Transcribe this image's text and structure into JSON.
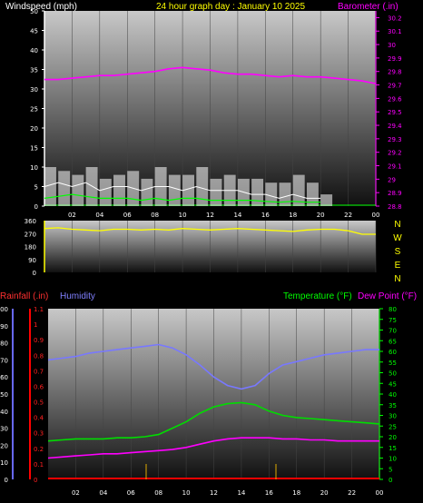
{
  "title": "24 hour graph day : January 10 2025",
  "colors": {
    "wind": "#ffffff",
    "gust_fill": "#ffffff",
    "wind_avg": "#00ff00",
    "barometer": "#ff00ff",
    "direction": "#ffff00",
    "rain": "#ff0000",
    "humidity": "#7070ff",
    "temperature": "#00dd00",
    "dewpoint": "#ff00ff",
    "title": "#ffff00"
  },
  "x_ticks": [
    "02",
    "04",
    "06",
    "08",
    "10",
    "12",
    "14",
    "16",
    "18",
    "20",
    "22",
    "00"
  ],
  "chart_data": [
    {
      "type": "line",
      "panel": "wind-barometer",
      "left_axis": {
        "label": "Windspeed (mph)",
        "range": [
          0,
          50
        ],
        "ticks": [
          "50",
          "45",
          "40",
          "35",
          "30",
          "25",
          "20",
          "15",
          "10",
          "5",
          "0"
        ]
      },
      "right_axis": {
        "label": "Barometer (.in)",
        "range": [
          28.8,
          30.25
        ],
        "ticks": [
          "30.2",
          "30.1",
          "30",
          "29.9",
          "29.8",
          "29.7",
          "29.6",
          "29.5",
          "29.4",
          "29.3",
          "29.2",
          "29.1",
          "29",
          "28.9",
          "28.8"
        ]
      },
      "x_hours": [
        0,
        1,
        2,
        3,
        4,
        5,
        6,
        7,
        8,
        9,
        10,
        11,
        12,
        13,
        14,
        15,
        16,
        17,
        18,
        19,
        20,
        21,
        22,
        23,
        24
      ],
      "series": [
        {
          "name": "Barometer (.in)",
          "values": [
            29.74,
            29.74,
            29.75,
            29.76,
            29.77,
            29.77,
            29.78,
            29.79,
            29.8,
            29.82,
            29.83,
            29.82,
            29.81,
            29.79,
            29.78,
            29.78,
            29.77,
            29.76,
            29.77,
            29.76,
            29.76,
            29.75,
            29.74,
            29.73,
            29.71
          ]
        },
        {
          "name": "Windspeed (mph)",
          "values": [
            5,
            6,
            5,
            6,
            4,
            5,
            5,
            4,
            5,
            5,
            4,
            5,
            4,
            4,
            4,
            3,
            3,
            2,
            3,
            2,
            2,
            null,
            null,
            null,
            null
          ]
        },
        {
          "name": "Gust",
          "values": [
            10,
            9,
            8,
            10,
            7,
            8,
            9,
            7,
            10,
            8,
            8,
            10,
            7,
            8,
            7,
            7,
            6,
            6,
            8,
            6,
            3,
            null,
            null,
            null,
            null
          ]
        },
        {
          "name": "Average",
          "values": [
            2,
            2.5,
            3,
            2.5,
            2,
            2,
            2,
            1.5,
            2,
            1.5,
            2,
            2,
            1.5,
            1.5,
            1.5,
            1.5,
            1.2,
            1,
            1.2,
            1,
            1,
            null,
            null,
            null,
            null
          ]
        }
      ]
    },
    {
      "type": "line",
      "panel": "wind-direction",
      "left_axis": {
        "range": [
          0,
          360
        ],
        "ticks": [
          "360",
          "270",
          "180",
          "90",
          "0"
        ]
      },
      "right_labels": [
        "N",
        "W",
        "S",
        "E",
        "N"
      ],
      "x_hours": [
        0,
        1,
        2,
        3,
        4,
        5,
        6,
        7,
        8,
        9,
        10,
        11,
        12,
        13,
        14,
        15,
        16,
        17,
        18,
        19,
        20,
        21,
        22,
        23,
        24
      ],
      "series": [
        {
          "name": "Direction",
          "values": [
            305,
            310,
            300,
            295,
            290,
            300,
            300,
            295,
            300,
            295,
            305,
            300,
            295,
            300,
            305,
            300,
            295,
            290,
            285,
            295,
            300,
            300,
            290,
            265,
            265
          ]
        }
      ]
    },
    {
      "type": "line",
      "panel": "rain-humidity-temperature",
      "rain_axis": {
        "label": "Rainfall (.in)",
        "range": [
          0,
          1.1
        ],
        "ticks": [
          "1.1",
          "1",
          "0.9",
          "0.8",
          "0.7",
          "0.6",
          "0.5",
          "0.4",
          "0.3",
          "0.2",
          "0.1",
          "0"
        ]
      },
      "humidity_axis": {
        "label": "Humidity",
        "range": [
          0,
          100
        ],
        "ticks": [
          "100",
          "90",
          "80",
          "70",
          "60",
          "50",
          "40",
          "30",
          "20",
          "10",
          "0"
        ]
      },
      "temp_axis": {
        "label": "Temperature (°F)",
        "label2": "Dew Point (°F)",
        "range": [
          0,
          80
        ],
        "ticks": [
          "80",
          "75",
          "70",
          "65",
          "60",
          "55",
          "50",
          "45",
          "40",
          "35",
          "30",
          "25",
          "20",
          "15",
          "10",
          "5",
          "0"
        ]
      },
      "x_hours": [
        0,
        1,
        2,
        3,
        4,
        5,
        6,
        7,
        8,
        9,
        10,
        11,
        12,
        13,
        14,
        15,
        16,
        17,
        18,
        19,
        20,
        21,
        22,
        23,
        24
      ],
      "series": [
        {
          "name": "Humidity",
          "values": [
            70,
            71,
            72,
            74,
            75,
            76,
            77,
            78,
            79,
            77,
            73,
            67,
            60,
            55,
            53,
            55,
            62,
            67,
            69,
            71,
            73,
            74,
            75,
            76,
            76
          ]
        },
        {
          "name": "Temperature (°F)",
          "values": [
            18,
            18.5,
            19,
            19,
            19,
            19.5,
            19.5,
            20,
            21,
            24,
            27,
            31,
            34,
            35.5,
            36,
            35,
            32,
            30,
            29,
            28.5,
            28,
            27.5,
            27,
            26.5,
            26
          ]
        },
        {
          "name": "Dew Point (°F)",
          "values": [
            10,
            10.5,
            11,
            11.5,
            12,
            12,
            12.5,
            13,
            13.5,
            14,
            15,
            16.5,
            18,
            19,
            19.5,
            19.5,
            19.5,
            19,
            19,
            18.5,
            18.5,
            18,
            18,
            18,
            18
          ]
        },
        {
          "name": "Rainfall (.in)",
          "values": [
            0,
            0,
            0,
            0,
            0,
            0,
            0,
            0,
            0,
            0,
            0,
            0,
            0,
            0,
            0,
            0,
            0,
            0,
            0,
            0,
            0,
            0,
            0,
            0,
            0
          ]
        }
      ]
    }
  ]
}
